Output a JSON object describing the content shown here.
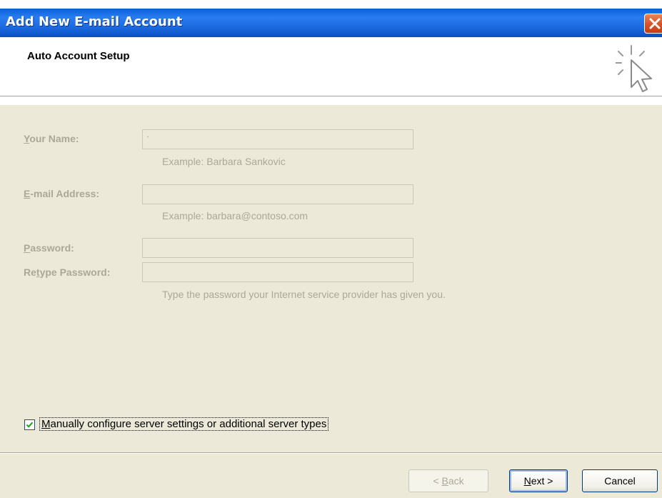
{
  "window": {
    "title": "Add New E-mail Account",
    "close_icon": "close-icon"
  },
  "header": {
    "title": "Auto Account Setup",
    "icon": "cursor-sparkle-icon"
  },
  "form": {
    "your_name": {
      "label_accel": "Y",
      "label_rest": "our Name:",
      "value": "`",
      "hint": "Example: Barbara Sankovic"
    },
    "email_address": {
      "label_accel": "E",
      "label_rest": "-mail Address:",
      "value": "",
      "hint": "Example: barbara@contoso.com"
    },
    "password": {
      "label_accel": "P",
      "label_rest": "assword:",
      "value": ""
    },
    "retype_password": {
      "label_pre": "Re",
      "label_accel": "t",
      "label_rest": "ype Password:",
      "value": "",
      "hint": "Type the password your Internet service provider has given you."
    }
  },
  "manual_config": {
    "checked": true,
    "label_accel": "M",
    "label_rest": "anually configure server settings or additional server types"
  },
  "buttons": {
    "back_pre": "< ",
    "back_accel": "B",
    "back_rest": "ack",
    "next_accel": "N",
    "next_rest": "ext >",
    "cancel": "Cancel"
  },
  "colors": {
    "titlebar": "#0a5fd8",
    "dialog_face": "#ece9d8",
    "disabled_text": "#aca899",
    "checkbox_check": "#21a121"
  }
}
